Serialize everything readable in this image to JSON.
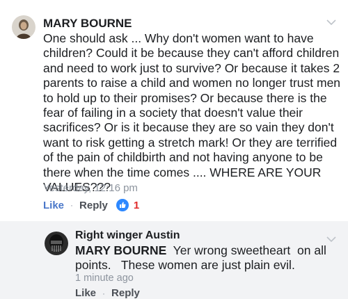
{
  "comment": {
    "author": "MARY BOURNE",
    "text": "One should ask ... Why don't women want to have\nchildren? Could it be because they can't afford children\nand need to work just to survive? Or because it takes 2\nparents to raise a child and women no longer trust men\nto hold up to their promises? Or because there is the\nfear of failing in a society that doesn't value their\nsacrifices? Or is it because they are so vain they don't\nwant to risk getting a stretch mark! Or they are terrified\nof the pain of childbirth and not having anyone to be\nthere when the time comes .... WHERE ARE YOUR\nVALUES???",
    "timestamp": "Yesterday, 12:16 pm",
    "like_label": "Like",
    "separator": "·",
    "reply_label": "Reply",
    "reaction_icon": "thumbs-up-icon",
    "reaction_count": "1"
  },
  "reply": {
    "author": "Right winger Austin",
    "mention": "MARY BOURNE",
    "text_line1": "  Yer wrong sweetheart  on all",
    "text_line2": "points.   These women are just plain evil.",
    "timestamp": "1 minute ago",
    "like_label": "Like",
    "separator": "·",
    "reply_label": "Reply"
  },
  "colors": {
    "link_blue": "#4a77c9",
    "reaction_blue": "#2d88ff",
    "reaction_count_red": "#e02b2b",
    "muted_gray": "#8d949e",
    "reply_background": "#f2f3f5"
  }
}
